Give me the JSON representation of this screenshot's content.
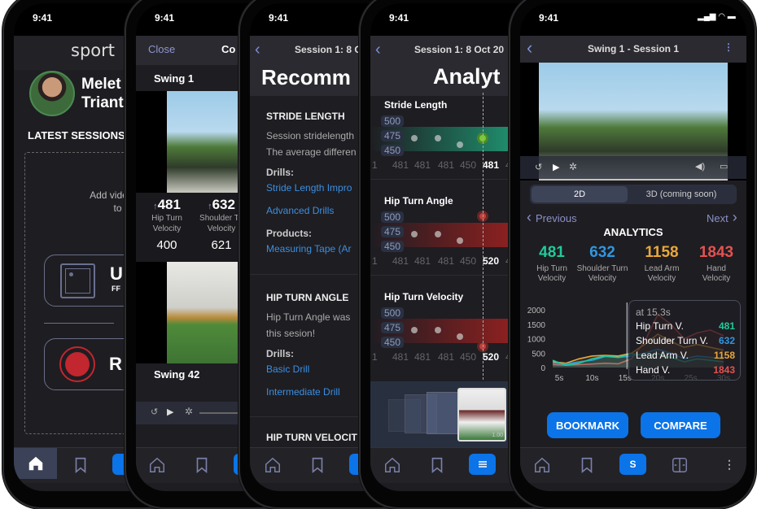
{
  "status_time": "9:41",
  "home": {
    "logo": "sport",
    "name_line1": "Melet",
    "name_line2": "Triant",
    "latest_sessions": "LATEST SESSIONS",
    "empty_line1": "Add videos of yo",
    "empty_line2": "to get",
    "upload_label": "U",
    "upload_sub": "FF",
    "record_label": "R"
  },
  "compare": {
    "close": "Close",
    "title": "Co",
    "swing1": "Swing 1",
    "stats": [
      {
        "value": "481",
        "label1": "Hip Turn",
        "label2": "Velocity",
        "compare": "400"
      },
      {
        "value": "632",
        "label1": "Shoulder Tu",
        "label2": "Velocity",
        "compare": "621"
      }
    ],
    "swing2": "Swing 42"
  },
  "recommendations": {
    "session": "Session 1: 8 O",
    "title": "Recomm",
    "stride_title": "STRIDE LENGTH",
    "stride_text1": "Session stridelength",
    "stride_text2": "The average differen",
    "drills": "Drills:",
    "stride_drill1": "Stride Length Impro",
    "stride_drill2": "Advanced Drills",
    "products": "Products:",
    "product1": "Measuring Tape (Ar",
    "hip_title": "HIP TURN ANGLE",
    "hip_text1": "Hip Turn Angle was",
    "hip_text2": "this sesion!",
    "hip_drill1": "Basic Drill",
    "hip_drill2": "Intermediate Drill",
    "velocity_title": "HIP TURN VELOCIT"
  },
  "analytics_trend": {
    "session": "Session 1: 8 Oct 20",
    "title": "Analyt",
    "y_labels": [
      "500",
      "475",
      "450"
    ],
    "metrics": [
      {
        "title": "Stride Length",
        "x_labels": [
          "1",
          "481",
          "481",
          "481",
          "450",
          "481",
          "4"
        ],
        "color": "#1f8a6a"
      },
      {
        "title": "Hip Turn Angle",
        "x_labels": [
          "1",
          "481",
          "481",
          "481",
          "450",
          "520",
          "4"
        ],
        "color": "#8a2020"
      },
      {
        "title": "Hip Turn Velocity",
        "x_labels": [
          "1",
          "481",
          "481",
          "481",
          "450",
          "520",
          "4"
        ],
        "color": "#8a2020"
      }
    ],
    "thumb_badge": "1.00"
  },
  "swing": {
    "title": "Swing 1 - Session 1",
    "tab_2d": "2D",
    "tab_3d": "3D (coming soon)",
    "previous": "Previous",
    "next": "Next",
    "analytics": "ANALYTICS",
    "metrics": [
      {
        "value": "481",
        "label1": "Hip Turn",
        "label2": "Velocity",
        "color": "#22c99a"
      },
      {
        "value": "632",
        "label1": "Shoulder Turn",
        "label2": "Velocity",
        "color": "#2f96e0"
      },
      {
        "value": "1158",
        "label1": "Lead Arm",
        "label2": "Velocity",
        "color": "#e9a73a"
      },
      {
        "value": "1843",
        "label1": "Hand",
        "label2": "Velocity",
        "color": "#e5524f"
      }
    ],
    "tooltip": {
      "at": "at 15.3s",
      "rows": [
        {
          "label": "Hip Turn V.",
          "value": "481"
        },
        {
          "label": "Shoulder Turn V.",
          "value": "632"
        },
        {
          "label": "Lead Arm V.",
          "value": "1158"
        },
        {
          "label": "Hand V.",
          "value": "1843"
        }
      ]
    },
    "bookmark": "BOOKMARK",
    "compare": "COMPARE",
    "nav_active": "S"
  },
  "chart_data": {
    "type": "area",
    "x_unit": "s",
    "y_ticks": [
      "2000",
      "1500",
      "1000",
      "500",
      "0"
    ],
    "x_ticks": [
      "5s",
      "10s",
      "15s",
      "20s",
      "25s",
      "30s"
    ],
    "ylim": [
      0,
      2000
    ],
    "xlim": [
      4,
      31
    ],
    "cursor_x": 15.3,
    "x": [
      4,
      6,
      8,
      10,
      12,
      14,
      16,
      18,
      20,
      22,
      24,
      26,
      28,
      30
    ],
    "series": [
      {
        "name": "Hand V.",
        "color": "#e5524f",
        "values": [
          100,
          80,
          100,
          120,
          150,
          130,
          300,
          900,
          1843,
          1500,
          1000,
          1200,
          1300,
          1100
        ]
      },
      {
        "name": "Lead Arm V.",
        "color": "#e9a73a",
        "values": [
          200,
          150,
          300,
          400,
          420,
          400,
          500,
          800,
          1158,
          900,
          700,
          800,
          700,
          600
        ]
      },
      {
        "name": "Shoulder Turn V.",
        "color": "#2f96e0",
        "values": [
          150,
          120,
          200,
          250,
          380,
          350,
          400,
          500,
          632,
          500,
          300,
          400,
          350,
          300
        ]
      },
      {
        "name": "Hip Turn V.",
        "color": "#22c99a",
        "values": [
          250,
          80,
          150,
          300,
          400,
          350,
          480,
          400,
          481,
          350,
          200,
          300,
          250,
          200
        ]
      }
    ]
  }
}
